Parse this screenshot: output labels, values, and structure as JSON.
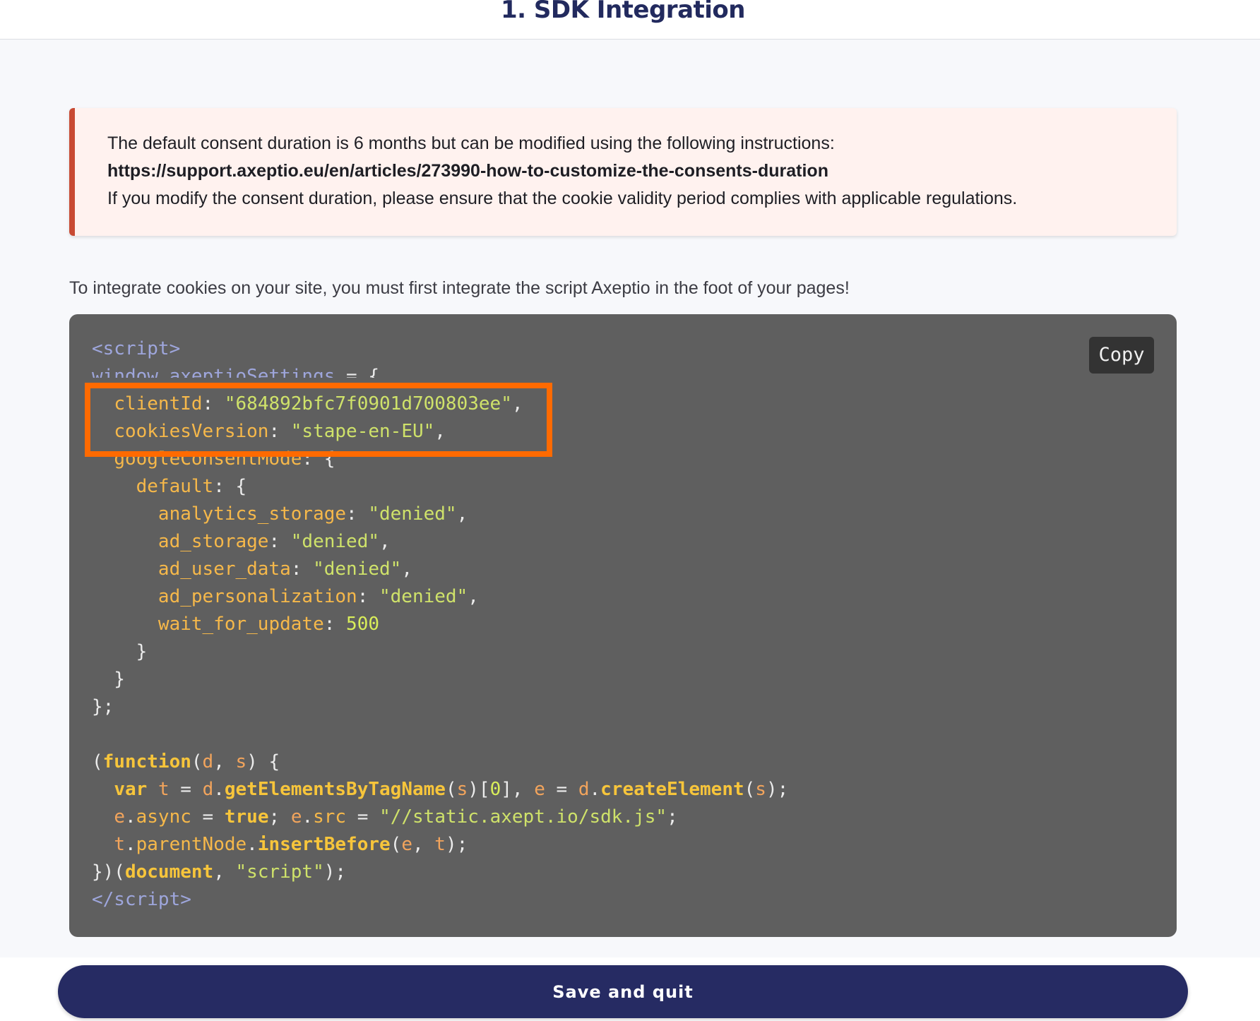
{
  "header": {
    "title": "1. SDK Integration"
  },
  "alert": {
    "line1": "The default consent duration is 6 months but can be modified using the following instructions:",
    "link": "https://support.axeptio.eu/en/articles/273990-how-to-customize-the-consents-duration",
    "line3": "If you modify the consent duration, please ensure that the cookie validity period complies with applicable regulations.",
    "accent_color": "#c84a33"
  },
  "intro_text": "To integrate cookies on your site, you must first integrate the script Axeptio in the foot of your pages!",
  "code": {
    "copy_label": "Copy",
    "client_id": "\"684892bfc7f0901d700803ee\"",
    "cookies_version": "\"stape-en-EU\"",
    "highlight_color": "#ff6a00"
  },
  "footer": {
    "save_label": "Save and quit",
    "button_color": "#262b63"
  }
}
